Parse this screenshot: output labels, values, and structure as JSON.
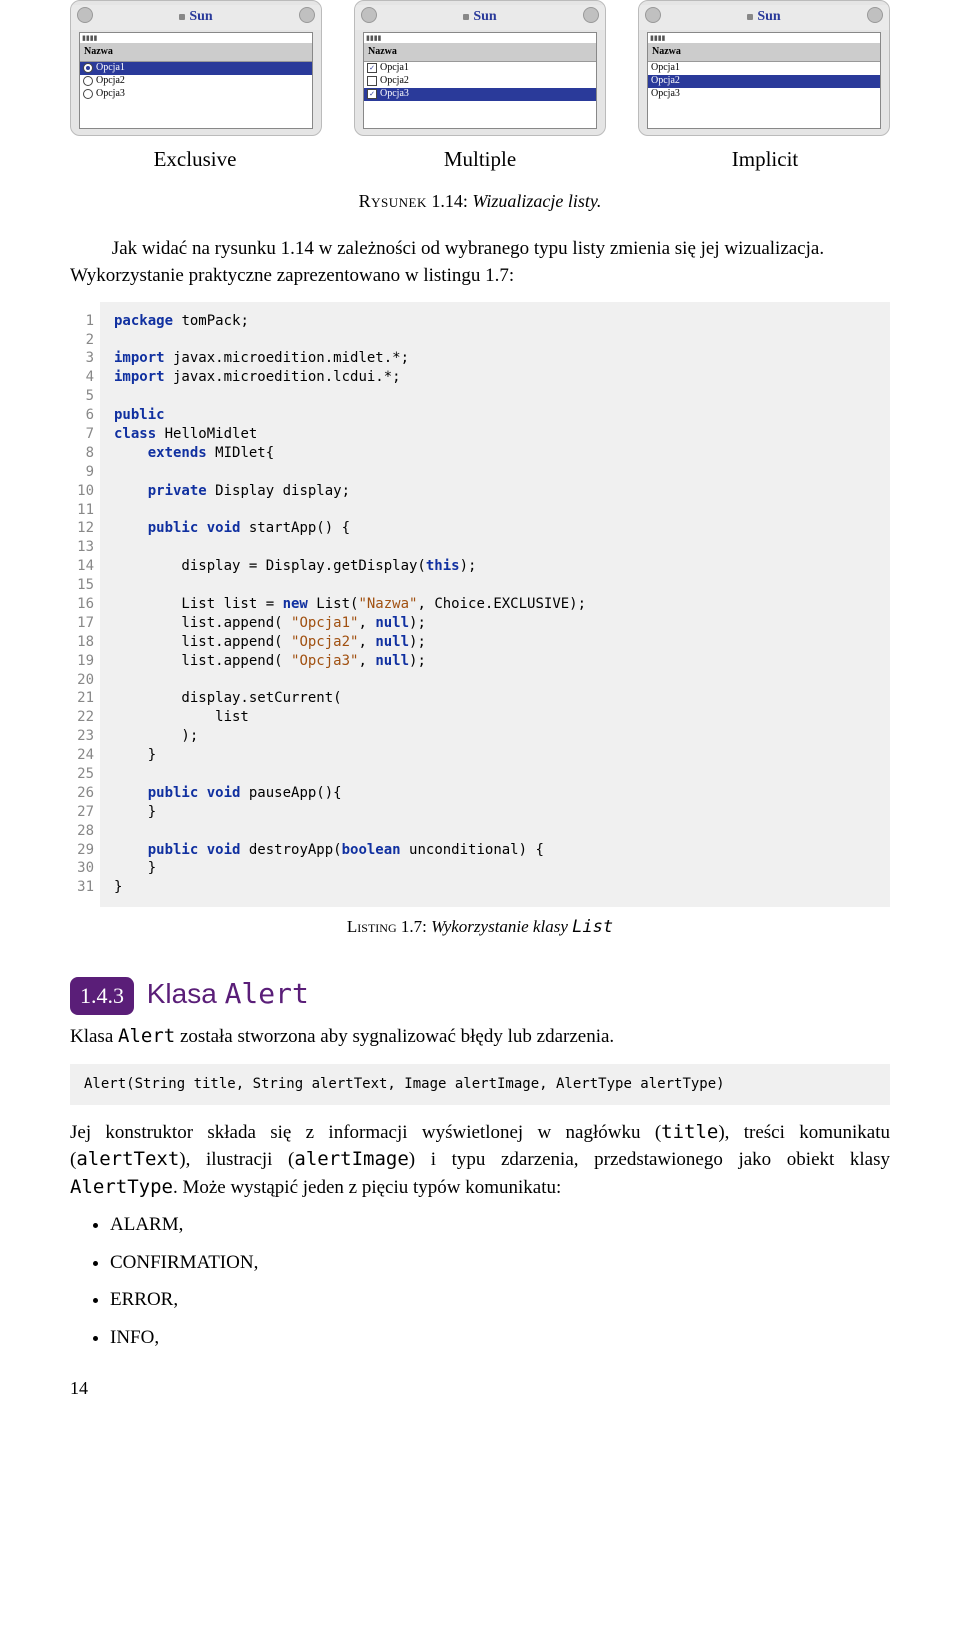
{
  "phones": {
    "sun_label": "Sun",
    "header": "Nazwa",
    "status": "▮▮▮▮",
    "items": [
      "Opcja1",
      "Opcja2",
      "Opcja3"
    ]
  },
  "labels": {
    "exclusive": "Exclusive",
    "multiple": "Multiple",
    "implicit": "Implicit"
  },
  "fig": {
    "sc": "Rysunek",
    "num": "1.14:",
    "it": "Wizualizacje listy."
  },
  "para1": "Jak widać na rysunku 1.14 w zależności od wybranego typu listy zmienia się jej wizualizacja. Wykorzystanie praktyczne zaprezentowano w listingu 1.7:",
  "code": {
    "l1_a": "package",
    "l1_b": " tomPack;",
    "l3_a": "import",
    "l3_b": " javax.microedition.midlet.*;",
    "l4_a": "import",
    "l4_b": " javax.microedition.lcdui.*;",
    "l6": "public",
    "l7_a": "class",
    "l7_b": " HelloMidlet",
    "l8_a": "extends",
    "l8_b": " MIDlet{",
    "l10_a": "private",
    "l10_b": " Display display;",
    "l12_a": "public void",
    "l12_b": " startApp() {",
    "l14_a": "        display = Display.getDisplay(",
    "l14_b": "this",
    "l14_c": ");",
    "l16_a": "        List list = ",
    "l16_kw": "new",
    "l16_b": " List(",
    "l16_s": "\"Nazwa\"",
    "l16_c": ", Choice.EXCLUSIVE);",
    "l17_a": "        list.append( ",
    "l17_s": "\"Opcja1\"",
    "l17_b": ", ",
    "l17_kw": "null",
    "l17_c": ");",
    "l18_a": "        list.append( ",
    "l18_s": "\"Opcja2\"",
    "l18_b": ", ",
    "l18_kw": "null",
    "l18_c": ");",
    "l19_a": "        list.append( ",
    "l19_s": "\"Opcja3\"",
    "l19_b": ", ",
    "l19_kw": "null",
    "l19_c": ");",
    "l21": "        display.setCurrent(",
    "l22": "            list",
    "l23": "        );",
    "l24": "    }",
    "l26_a": "public void",
    "l26_b": " pauseApp(){",
    "l27": "    }",
    "l29_a": "public void",
    "l29_b": " destroyApp(",
    "l29_c": "boolean",
    "l29_d": " unconditional) {",
    "l30": "    }",
    "l31": "}"
  },
  "listing": {
    "sc": "Listing",
    "num": "1.7:",
    "it_a": "Wykorzystanie klasy ",
    "tt": "List"
  },
  "section": {
    "num": "1.4.3",
    "title_a": "Klasa ",
    "title_tt": "Alert"
  },
  "para2": {
    "a": "Klasa ",
    "tt": "Alert",
    "b": " została stworzona aby sygnalizować błędy lub zdarzenia."
  },
  "alert_sig": "Alert(String title, String alertText, Image alertImage, AlertType alertType)",
  "para3": {
    "a": "Jej konstruktor składa się z informacji wyświetlonej w nagłówku (",
    "t1": "title",
    "b": "), treści komunikatu (",
    "t2": "alertText",
    "c": "), ilustracji (",
    "t3": "alertImage",
    "d": ") i typu zdarzenia, przedstawionego jako obiekt klasy ",
    "t4": "AlertType",
    "e": ". Może wystąpić jeden z pięciu typów komunikatu:"
  },
  "bullets": [
    "ALARM,",
    "CONFIRMATION,",
    "ERROR,",
    "INFO,"
  ],
  "page_num": "14",
  "linenums": [
    "1",
    "2",
    "3",
    "4",
    "5",
    "6",
    "7",
    "8",
    "9",
    "10",
    "11",
    "12",
    "13",
    "14",
    "15",
    "16",
    "17",
    "18",
    "19",
    "20",
    "21",
    "22",
    "23",
    "24",
    "25",
    "26",
    "27",
    "28",
    "29",
    "30",
    "31"
  ]
}
